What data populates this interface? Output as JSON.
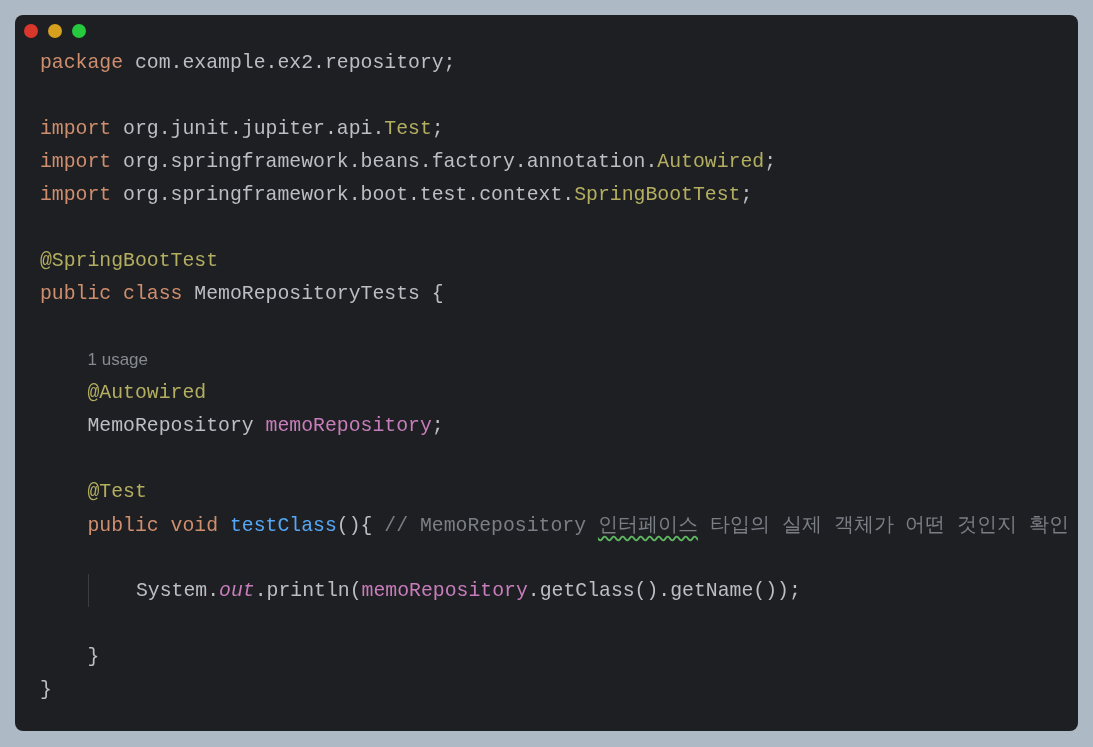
{
  "window": {
    "controls": [
      {
        "kind": "close"
      },
      {
        "kind": "minimize"
      },
      {
        "kind": "zoom"
      }
    ]
  },
  "code": [
    {
      "tokens": [
        {
          "kind": "keyword",
          "text": "package"
        },
        {
          "kind": "plain",
          "text": " com.example.ex2.repository;"
        }
      ]
    },
    {
      "gap_before": true,
      "tokens": [
        {
          "kind": "keyword",
          "text": "import"
        },
        {
          "kind": "plain",
          "text": " org.junit.jupiter.api."
        },
        {
          "kind": "annotation",
          "text": "Test"
        },
        {
          "kind": "plain",
          "text": ";"
        }
      ]
    },
    {
      "tokens": [
        {
          "kind": "keyword",
          "text": "import"
        },
        {
          "kind": "plain",
          "text": " org.springframework.beans.factory.annotation."
        },
        {
          "kind": "annotation",
          "text": "Autowired"
        },
        {
          "kind": "plain",
          "text": ";"
        }
      ]
    },
    {
      "tokens": [
        {
          "kind": "keyword",
          "text": "import"
        },
        {
          "kind": "plain",
          "text": " org.springframework.boot.test.context."
        },
        {
          "kind": "annotation",
          "text": "SpringBootTest"
        },
        {
          "kind": "plain",
          "text": ";"
        }
      ]
    },
    {
      "gap_before": true,
      "tokens": [
        {
          "kind": "annotation",
          "text": "@SpringBootTest"
        }
      ]
    },
    {
      "tokens": [
        {
          "kind": "keyword",
          "text": "public class"
        },
        {
          "kind": "plain",
          "text": " MemoRepositoryTests {"
        }
      ],
      "children": [
        {
          "gap_before": true,
          "tokens": [
            {
              "kind": "hint",
              "text": "1 usage"
            }
          ]
        },
        {
          "tokens": [
            {
              "kind": "annotation",
              "text": "@Autowired"
            }
          ]
        },
        {
          "tokens": [
            {
              "kind": "plain",
              "text": "MemoRepository "
            },
            {
              "kind": "field",
              "text": "memoRepository"
            },
            {
              "kind": "plain",
              "text": ";"
            }
          ]
        },
        {
          "gap_before": true,
          "tokens": [
            {
              "kind": "annotation",
              "text": "@Test"
            }
          ]
        },
        {
          "tokens": [
            {
              "kind": "keyword",
              "text": "public void"
            },
            {
              "kind": "method",
              "text": " testClass"
            },
            {
              "kind": "plain",
              "text": "(){ "
            },
            {
              "kind": "comment",
              "text": "// MemoRepository "
            },
            {
              "kind": "comment",
              "text": "인터페이스",
              "typo": true
            },
            {
              "kind": "comment",
              "text": " 타입의 실제 객체가 어떤 것인지 확인"
            }
          ],
          "children": [
            {
              "gap_before": true,
              "gap_after": true,
              "tokens": [
                {
                  "kind": "plain",
                  "text": "System."
                },
                {
                  "kind": "static",
                  "text": "out"
                },
                {
                  "kind": "plain",
                  "text": ".println("
                },
                {
                  "kind": "field",
                  "text": "memoRepository"
                },
                {
                  "kind": "plain",
                  "text": ".getClass().getName());"
                }
              ]
            }
          ]
        },
        {
          "tokens": [
            {
              "kind": "plain",
              "text": "}"
            }
          ]
        }
      ]
    },
    {
      "tokens": [
        {
          "kind": "plain",
          "text": "}"
        }
      ]
    }
  ]
}
